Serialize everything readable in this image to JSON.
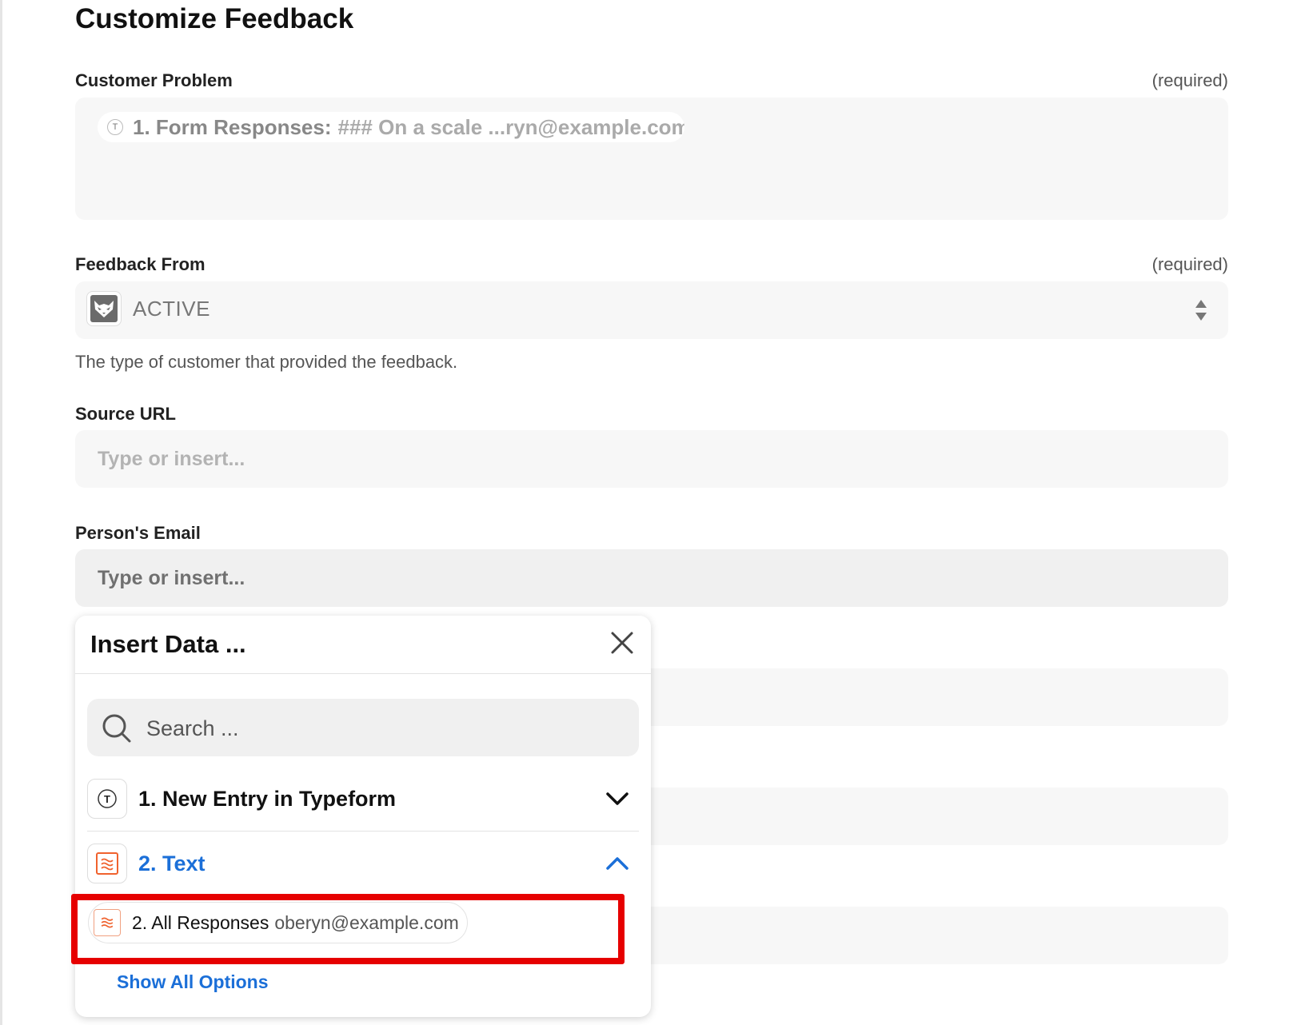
{
  "page": {
    "title": "Customize Feedback"
  },
  "fields": {
    "customer_problem": {
      "label": "Customer Problem",
      "required": "(required)",
      "token": {
        "key": "1. Form Responses:",
        "value": "### On a scale ...ryn@example.com"
      }
    },
    "feedback_from": {
      "label": "Feedback From",
      "required": "(required)",
      "value": "ACTIVE",
      "help": "The type of customer that provided the feedback."
    },
    "source_url": {
      "label": "Source URL",
      "placeholder": "Type or insert..."
    },
    "persons_email": {
      "label": "Person's Email",
      "placeholder": "Type or insert..."
    }
  },
  "insert_panel": {
    "title": "Insert Data ...",
    "search_placeholder": "Search ...",
    "steps": [
      {
        "label": "1. New Entry in Typeform",
        "icon": "typeform-icon",
        "expanded": false
      },
      {
        "label": "2. Text",
        "icon": "formatter-icon",
        "expanded": true
      }
    ],
    "option": {
      "key": "2. All Responses",
      "value": "oberyn@example.com"
    },
    "show_all": "Show All Options"
  },
  "colors": {
    "accent_blue": "#1b6fd8",
    "highlight_red": "#e60000",
    "formatter_orange": "#f0622e"
  }
}
